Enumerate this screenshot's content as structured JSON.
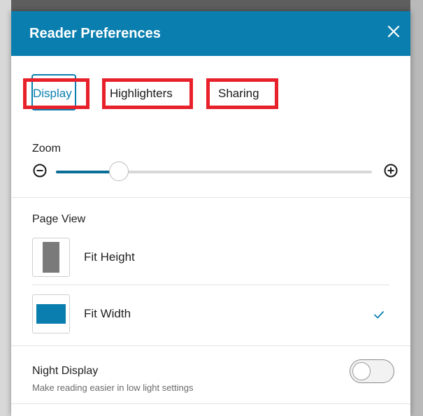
{
  "dialog": {
    "title": "Reader Preferences",
    "close_icon": "close-icon"
  },
  "tabs": [
    {
      "label": "Display",
      "active": true
    },
    {
      "label": "Highlighters",
      "active": false
    },
    {
      "label": "Sharing",
      "active": false
    }
  ],
  "zoom": {
    "label": "Zoom",
    "minus_icon": "zoom-out-icon",
    "plus_icon": "zoom-in-icon",
    "level_fraction": 0.2
  },
  "page_view": {
    "label": "Page View",
    "options": [
      {
        "label": "Fit Height",
        "selected": false
      },
      {
        "label": "Fit Width",
        "selected": true
      }
    ]
  },
  "night_display": {
    "title": "Night Display",
    "description": "Make reading easier in low light settings",
    "enabled": false
  },
  "colors": {
    "header": "#0a7faf",
    "accent": "#0a7faf",
    "highlight_box": "#e8202a",
    "fit_height_swatch": "#7a7a7a",
    "fit_width_swatch": "#0a7faf"
  }
}
